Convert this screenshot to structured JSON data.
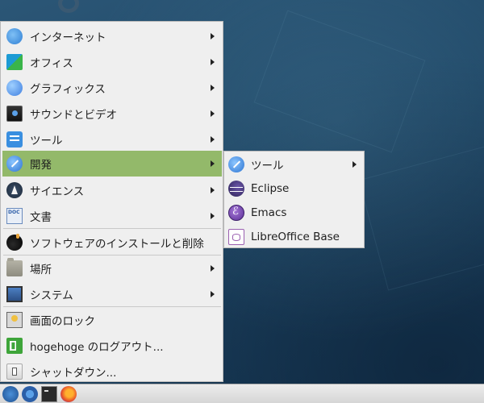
{
  "main_menu": {
    "items": [
      {
        "label": "インターネット",
        "icon": "globe-icon",
        "submenu": true
      },
      {
        "label": "オフィス",
        "icon": "office-icon",
        "submenu": true
      },
      {
        "label": "グラフィックス",
        "icon": "graphics-icon",
        "submenu": true
      },
      {
        "label": "サウンドとビデオ",
        "icon": "multimedia-icon",
        "submenu": true
      },
      {
        "label": "ツール",
        "icon": "tools-icon",
        "submenu": true
      },
      {
        "label": "開発",
        "icon": "development-icon",
        "submenu": true,
        "active": true
      },
      {
        "label": "サイエンス",
        "icon": "science-icon",
        "submenu": true
      },
      {
        "label": "文書",
        "icon": "document-icon",
        "submenu": true
      },
      {
        "label": "ソフトウェアのインストールと削除",
        "icon": "software-install-icon",
        "submenu": false
      },
      {
        "label": "場所",
        "icon": "folder-icon",
        "submenu": true
      },
      {
        "label": "システム",
        "icon": "system-icon",
        "submenu": true
      },
      {
        "label": "画面のロック",
        "icon": "lock-screen-icon",
        "submenu": false
      },
      {
        "label": "hogehoge のログアウト...",
        "icon": "logout-icon",
        "submenu": false
      },
      {
        "label": "シャットダウン...",
        "icon": "shutdown-icon",
        "submenu": false
      }
    ]
  },
  "dev_submenu": {
    "items": [
      {
        "label": "ツール",
        "icon": "tools-icon",
        "submenu": true
      },
      {
        "label": "Eclipse",
        "icon": "eclipse-icon",
        "submenu": false
      },
      {
        "label": "Emacs",
        "icon": "emacs-icon",
        "submenu": false
      },
      {
        "label": "LibreOffice Base",
        "icon": "libreoffice-base-icon",
        "submenu": false
      }
    ]
  },
  "taskbar": {
    "launchers": [
      "app-menu-icon",
      "settings-icon",
      "terminal-icon",
      "firefox-icon"
    ]
  },
  "colors": {
    "active_item": "#93b96a",
    "menu_bg": "#efefef",
    "desktop": "#1f4766"
  }
}
